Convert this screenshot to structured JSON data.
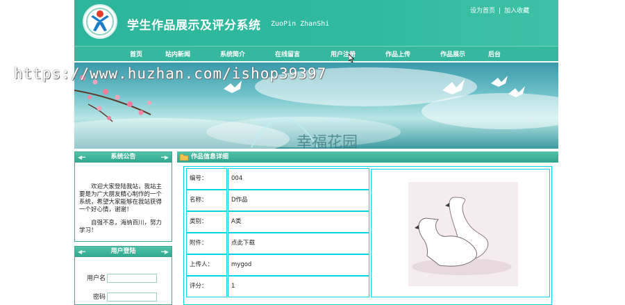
{
  "header": {
    "title": "学生作品展示及评分系统",
    "subtitle": "ZuoPin ZhanShi",
    "links": [
      "设为首页",
      "加入收藏"
    ],
    "separator": "|"
  },
  "nav": {
    "items": [
      "首页",
      "站内新闻",
      "系统简介",
      "在线留言",
      "用户注册",
      "作品上传",
      "作品展示",
      "后台"
    ]
  },
  "banner": {
    "art_text": "幸福花园",
    "watermark": "https://www.huzhan.com/ishop39397"
  },
  "sidebar": {
    "notice": {
      "title": "系统公告",
      "paragraphs": [
        "欢迎大家登陆我站，我站主要是为广大朋友精心制作的一个系统，希望大家能够在我站获得一个好心情，谢谢！",
        "自强不息，海纳百川，努力学习！"
      ]
    },
    "login": {
      "title": "用户登陆",
      "username_label": "用户名",
      "password_label": "密码"
    }
  },
  "main": {
    "title": "作品信息详细",
    "fields": [
      {
        "label": "编号：",
        "value": "004"
      },
      {
        "label": "名称：",
        "value": "D作品"
      },
      {
        "label": "类别：",
        "value": "A类"
      },
      {
        "label": "附件：",
        "value": "点此下载"
      },
      {
        "label": "上传人：",
        "value": "mygod"
      },
      {
        "label": "评分：",
        "value": "1"
      }
    ],
    "image_icon": "swan-image"
  },
  "colors": {
    "header": "#2db69b",
    "nav": "#36b89e",
    "border": "#00d5e6",
    "box_border": "#3aaa92"
  }
}
